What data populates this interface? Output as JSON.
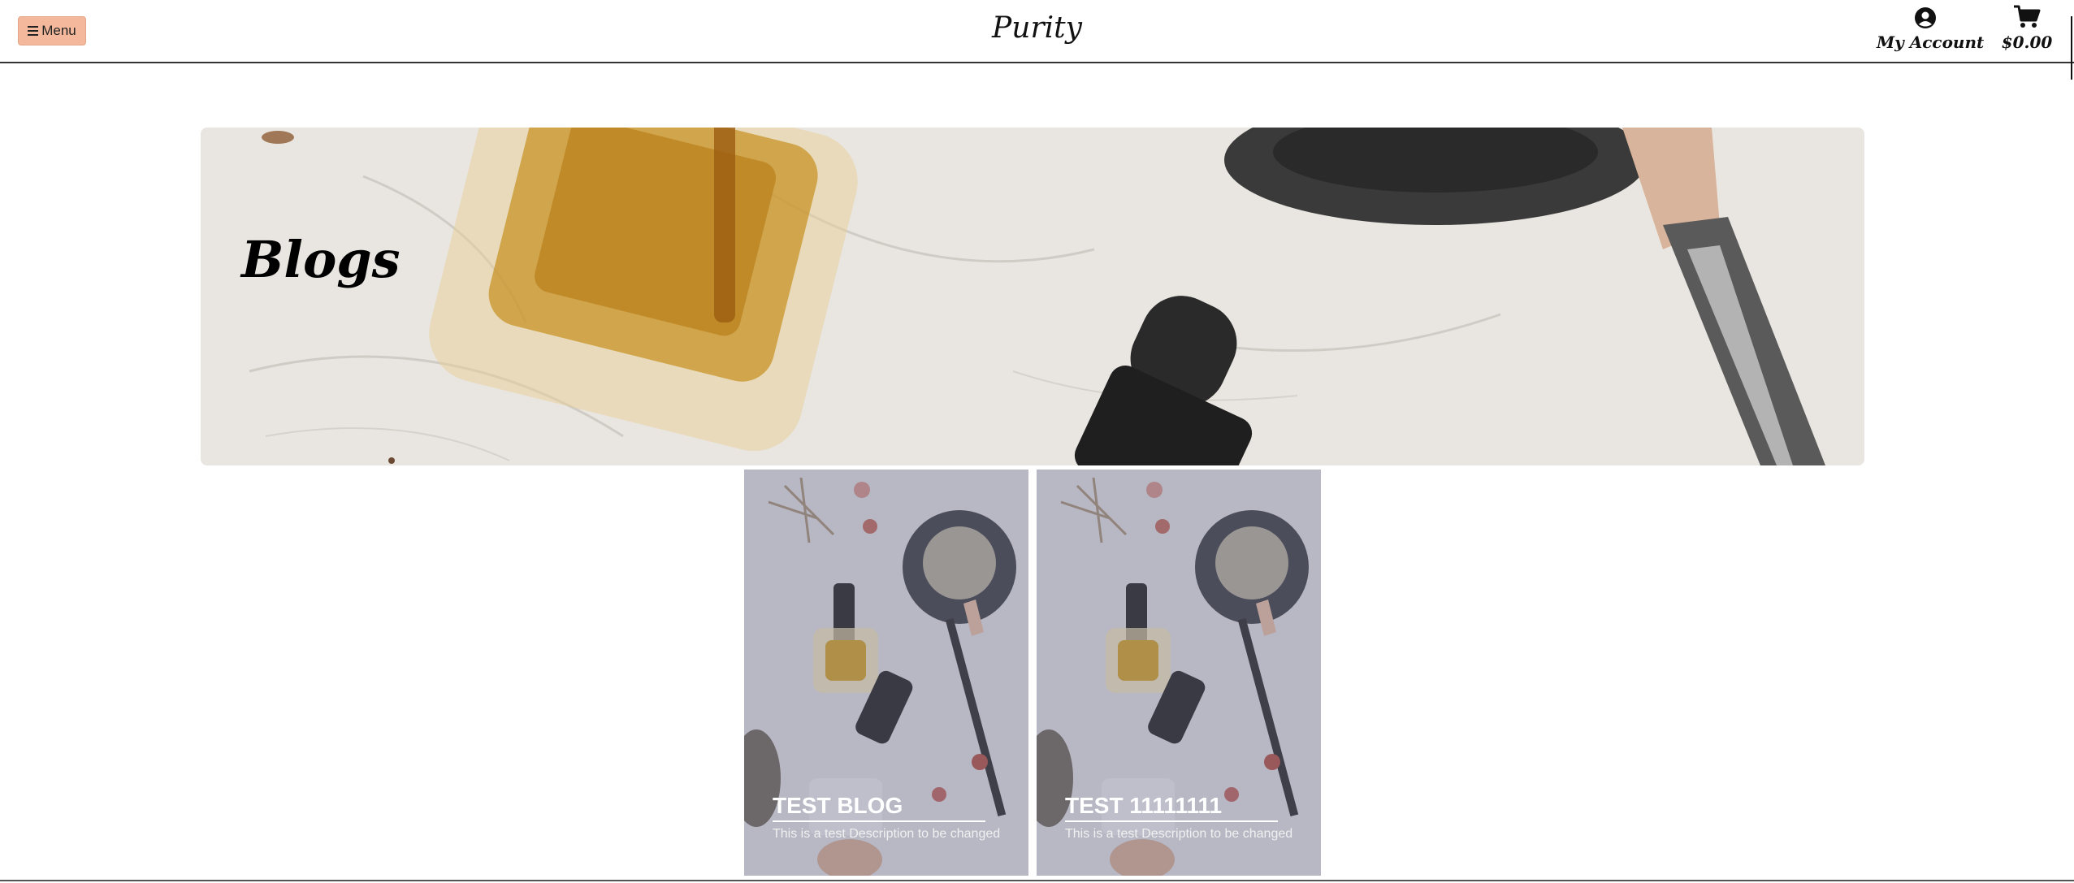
{
  "header": {
    "menu_label": "Menu",
    "brand": "Purity",
    "account_label": "My Account",
    "cart_total": "$0.00"
  },
  "hero": {
    "title": "Blogs"
  },
  "posts": [
    {
      "title": "TEST BLOG",
      "description": "This is a test Description to be changed"
    },
    {
      "title": "TEST 11111111",
      "description": "This is a test Description to be changed"
    }
  ],
  "colors": {
    "menu_button_bg": "#f4b99d",
    "card_overlay": "#6e7396"
  },
  "icons": {
    "menu": "hamburger-icon",
    "account": "user-circle-icon",
    "cart": "shopping-cart-icon"
  }
}
